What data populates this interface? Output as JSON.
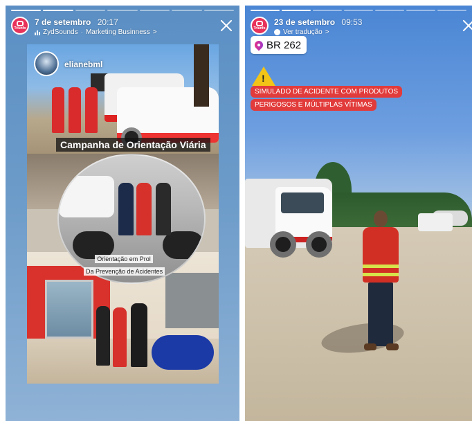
{
  "stories": [
    {
      "date": "7 de setembro",
      "time": "20:17",
      "account": "ZydSounds",
      "subtitle": "Marketing Businness",
      "subtitle_chevron": ">",
      "avatar_text": "Triunfo",
      "progress": {
        "segments": 7,
        "completed": 2
      },
      "content": {
        "username": "elianebml",
        "campaign_caption": "Campanha de Orientação Viária",
        "caption_line1": "Orientação em Prol",
        "caption_line2": "Da Prevenção de Acidentes"
      }
    },
    {
      "date": "23 de setembro",
      "time": "09:53",
      "translate_label": "Ver tradução",
      "translate_chevron": ">",
      "avatar_text": "Triunfo",
      "progress": {
        "segments": 7,
        "completed": 2
      },
      "content": {
        "location": "BR 262",
        "alert_line1": "SIMULADO DE ACIDENTE COM PRODUTOS",
        "alert_line2": "PERIGOSOS E MÚLTIPLAS VÍTIMAS",
        "warning_mark": "!"
      }
    }
  ],
  "icons": {
    "close": "close-icon",
    "music": "music-bars-icon",
    "globe": "globe-icon",
    "location_pin": "location-pin-icon",
    "warning": "warning-triangle-icon"
  },
  "colors": {
    "brand_pink": "#e8325a",
    "alert_red": "#e23b3b",
    "warning_yellow": "#f2c417"
  }
}
